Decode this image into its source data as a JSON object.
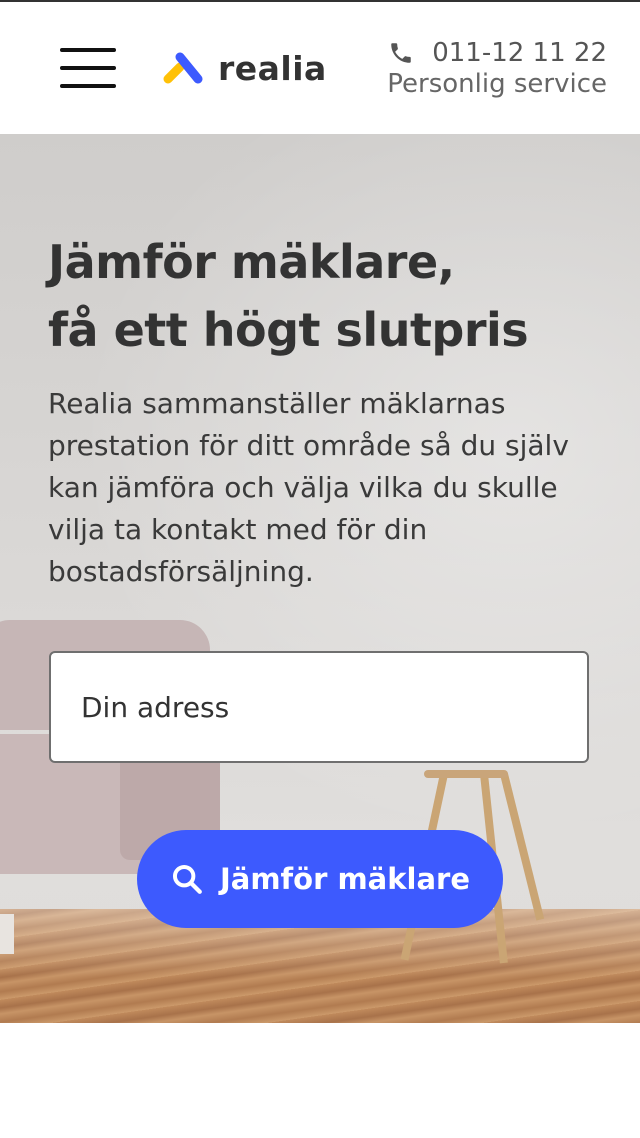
{
  "header": {
    "logo_text": "realia",
    "phone_number": "011-12 11 22",
    "service_label": "Personlig service"
  },
  "hero": {
    "title_line1": "Jämför mäklare,",
    "title_line2": "få ett högt slutpris",
    "description": "Realia sammanställer mäklarnas prestation för ditt område så du själv kan jämföra och välja vilka du skulle vilja ta kontakt med för din bostadsförsäljning.",
    "address_placeholder": "Din adress",
    "address_value": "",
    "cta_label": "Jämför mäklare"
  },
  "icons": {
    "menu": "hamburger-menu-icon",
    "logo": "realia-logo-icon",
    "phone": "phone-icon",
    "search": "search-icon"
  },
  "colors": {
    "accent": "#3d5afe",
    "logo_blue": "#3d5afe",
    "logo_yellow": "#ffc107",
    "text": "#333333"
  }
}
